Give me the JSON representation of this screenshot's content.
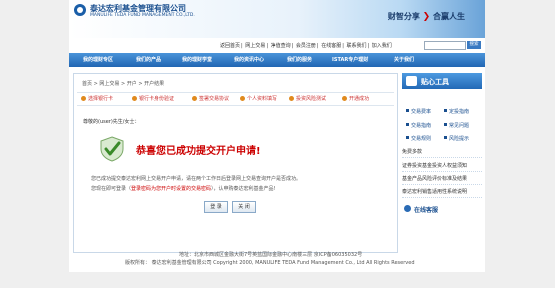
{
  "header": {
    "logo_cn": "泰达宏利基金管理有限公司",
    "logo_en": "MANULIFE TEDA FUND MANAGEMENT CO.,LTD.",
    "slogan_left": "财智分享",
    "slogan_right": "合赢人生"
  },
  "toplinks": [
    "返回首页",
    "网上交易",
    "净值查询",
    "会员注册",
    "在线客服",
    "联系我们",
    "加入我们"
  ],
  "search": {
    "button": "搜索"
  },
  "nav": [
    "我的理财专区",
    "我们的产品",
    "我的理财学堂",
    "我的资讯中心",
    "我们的服务",
    "ISTAR专户理财",
    "关于我们"
  ],
  "breadcrumb": "首页 > 网上交易 > 开户 > 开户结果",
  "steps": [
    "选择银行卡",
    "银行卡身份验证",
    "签署交易协议",
    "个人资料填写",
    "投资风险测试",
    "开通成功"
  ],
  "main": {
    "greeting": "尊敬的(user)先生/女士：",
    "success": "恭喜您已成功提交开户申请!",
    "msg1": "您已成功提交泰达宏利网上交易开户申请，请在两个工作日后登录网上交易查询开户是否成功。",
    "msg2_pre": "您现在即可登录（",
    "msg2_red": "登录密码为您开户时设置的交易密码",
    "msg2_post": "），认申购泰达宏利基金产品!",
    "btn_login": "登 录",
    "btn_close": "关 闭"
  },
  "side": {
    "tools_title": "贴心工具",
    "links": [
      [
        "交易费率",
        "定投指南"
      ],
      [
        "交易指南",
        "常见问题"
      ],
      [
        "交易规则",
        "风险提示"
      ]
    ],
    "rows": [
      "免费多款",
      "证券投资基金投资人权益须知",
      "基金产品风险评价标准及结果",
      "泰达宏利销售适用性系统说明"
    ],
    "cs_title": "在线客服"
  },
  "footer": {
    "address": "地址：北京市西城区金融大街7号英蓝国际金融中心南楼三层 京ICP备06035032号",
    "copyright": "版权所有：  泰达宏利基金管理有限公司 Copyright 2000, MANULIFE TEDA Fund Management Co., Ltd All Rights Reserved"
  }
}
